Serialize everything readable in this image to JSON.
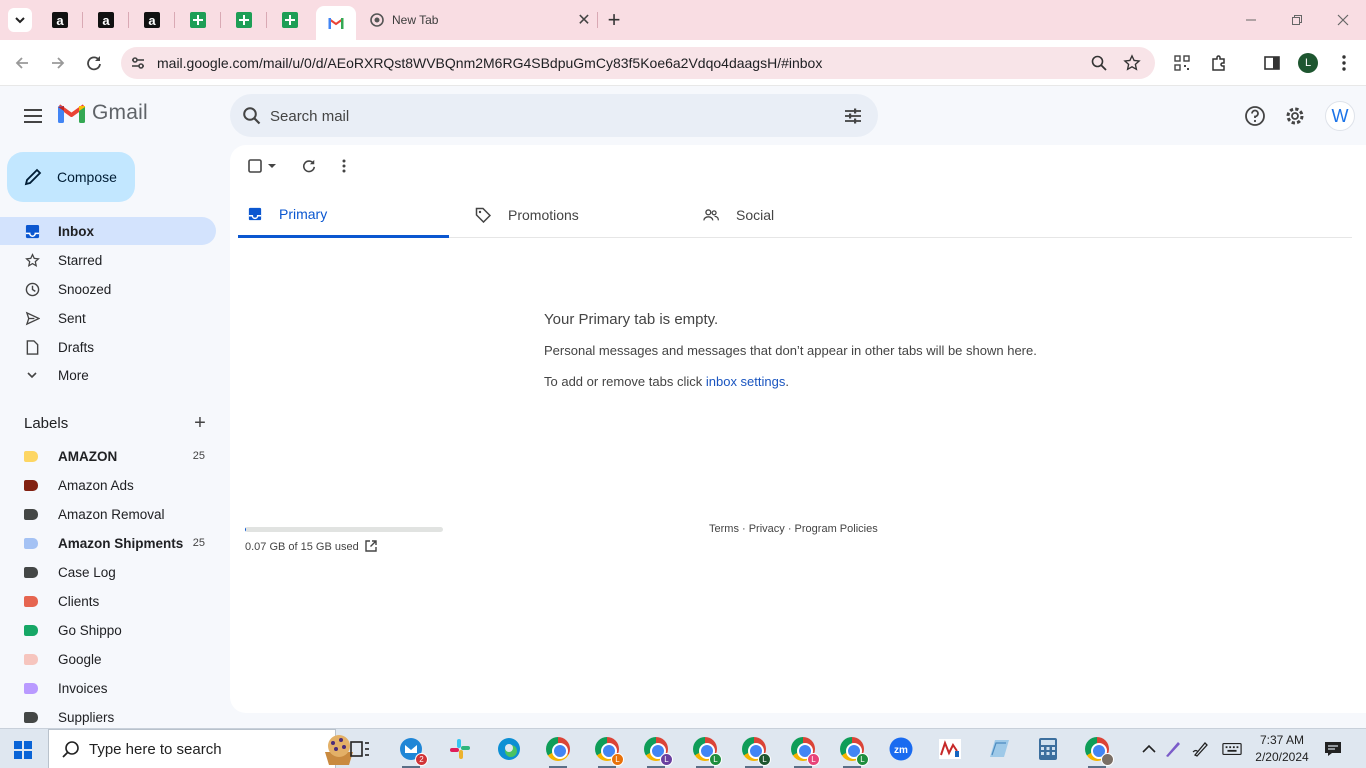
{
  "browser": {
    "pinned_tabs": [
      {
        "icon": "amazon-icon"
      },
      {
        "icon": "amazon-icon"
      },
      {
        "icon": "amazon-icon"
      },
      {
        "icon": "sheets-icon"
      },
      {
        "icon": "sheets-icon"
      },
      {
        "icon": "sheets-icon"
      }
    ],
    "active_tab_icon": "gmail-icon",
    "new_tab_title": "New Tab",
    "address_url": "mail.google.com/mail/u/0/d/AEoRXRQst8WVBQnm2M6RG4SBdpuGmCy83f5Koe6a2Vdqo4daagsH/#inbox",
    "profile_initial": "L",
    "tab_strip_color": "#f9dde3"
  },
  "gmail": {
    "brand": "Gmail",
    "search_placeholder": "Search mail",
    "account_initial": "W",
    "compose_label": "Compose",
    "nav": [
      {
        "label": "Inbox",
        "icon": "inbox-icon",
        "active": true
      },
      {
        "label": "Starred",
        "icon": "star-icon"
      },
      {
        "label": "Snoozed",
        "icon": "clock-icon"
      },
      {
        "label": "Sent",
        "icon": "send-icon"
      },
      {
        "label": "Drafts",
        "icon": "draft-icon"
      },
      {
        "label": "More",
        "icon": "chevron-down-icon"
      }
    ],
    "labels_title": "Labels",
    "labels": [
      {
        "name": "AMAZON",
        "count": "25",
        "bold": true,
        "color": "#fdd663"
      },
      {
        "name": "Amazon Ads",
        "count": "",
        "color": "#822111"
      },
      {
        "name": "Amazon Removal",
        "count": "",
        "color": "#444746"
      },
      {
        "name": "Amazon Shipments",
        "count": "25",
        "bold": true,
        "color": "#a4c2f4"
      },
      {
        "name": "Case Log",
        "count": "",
        "color": "#444746"
      },
      {
        "name": "Clients",
        "count": "",
        "color": "#e66550"
      },
      {
        "name": "Go Shippo",
        "count": "",
        "color": "#16a766"
      },
      {
        "name": "Google",
        "count": "",
        "color": "#f6c5be"
      },
      {
        "name": "Invoices",
        "count": "",
        "color": "#b99aff"
      },
      {
        "name": "Suppliers",
        "count": "",
        "color": "#444746"
      }
    ],
    "tabs": [
      {
        "label": "Primary",
        "icon": "inbox-tab-icon",
        "active": true
      },
      {
        "label": "Promotions",
        "icon": "tag-icon"
      },
      {
        "label": "Social",
        "icon": "people-icon"
      }
    ],
    "empty_state": {
      "title": "Your Primary tab is empty.",
      "line1": "Personal messages and messages that don’t appear in other tabs will be shown here.",
      "line2_prefix": "To add or remove tabs click ",
      "line2_link": "inbox settings",
      "line2_suffix": "."
    },
    "storage": {
      "text": "0.07 GB of 15 GB used",
      "used_fraction": 0.005
    },
    "footer": "Terms · Privacy · Program Policies"
  },
  "taskbar": {
    "search_placeholder": "Type here to search",
    "mail_badge": "2",
    "time": "7:37 AM",
    "date": "2/20/2024",
    "profile_badges": [
      "L",
      "L",
      "L",
      "L",
      "L",
      "L"
    ]
  }
}
